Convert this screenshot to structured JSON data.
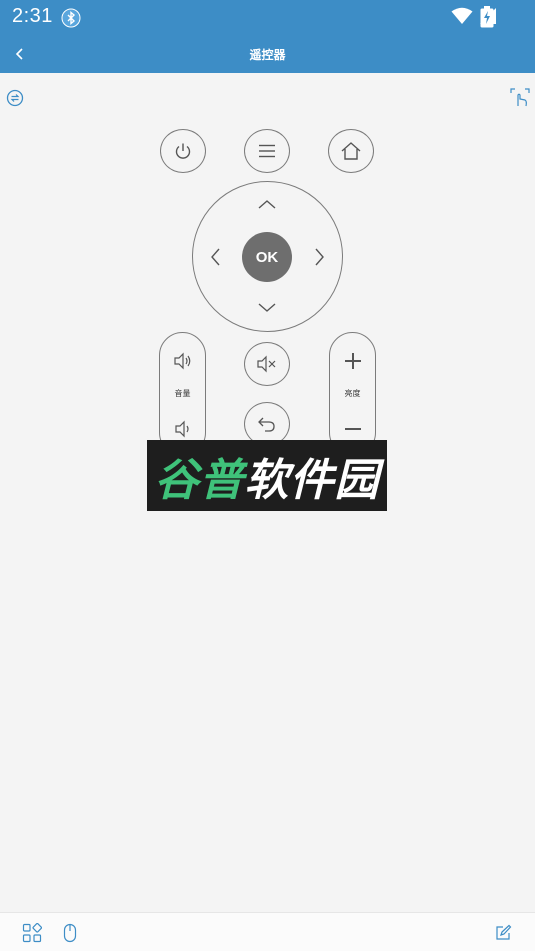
{
  "status_bar": {
    "time": "2:31",
    "icons": [
      "bluetooth-icon",
      "wifi-icon",
      "signal-icon",
      "battery-charging-icon"
    ]
  },
  "app_bar": {
    "title": "遥控器",
    "back_icon": "chevron-left-icon"
  },
  "corners": {
    "left_icon": "switch-device-icon",
    "right_icon": "touch-mode-icon"
  },
  "remote": {
    "top_row": [
      "power-icon",
      "menu-icon",
      "home-icon"
    ],
    "dpad": {
      "ok_label": "OK",
      "arrows": [
        "up",
        "left",
        "right",
        "down"
      ]
    },
    "volume": {
      "label": "音量",
      "up_icon": "volume-up-icon",
      "down_icon": "volume-down-icon"
    },
    "brightness": {
      "label": "亮度",
      "up_icon": "plus-icon",
      "down_icon": "minus-icon"
    },
    "center_column": [
      "mute-icon",
      "return-icon"
    ]
  },
  "watermark": {
    "text_green": "谷普",
    "text_white": "软件园"
  },
  "bottom_bar": {
    "icons": [
      "apps-grid-icon",
      "mouse-icon",
      "edit-icon"
    ]
  },
  "colors": {
    "primary": "#3d8dc6",
    "background": "#f4f4f4",
    "ok_button": "#6e6e6e",
    "outline": "#7b7b7b",
    "watermark_green": "#3fc27a"
  }
}
